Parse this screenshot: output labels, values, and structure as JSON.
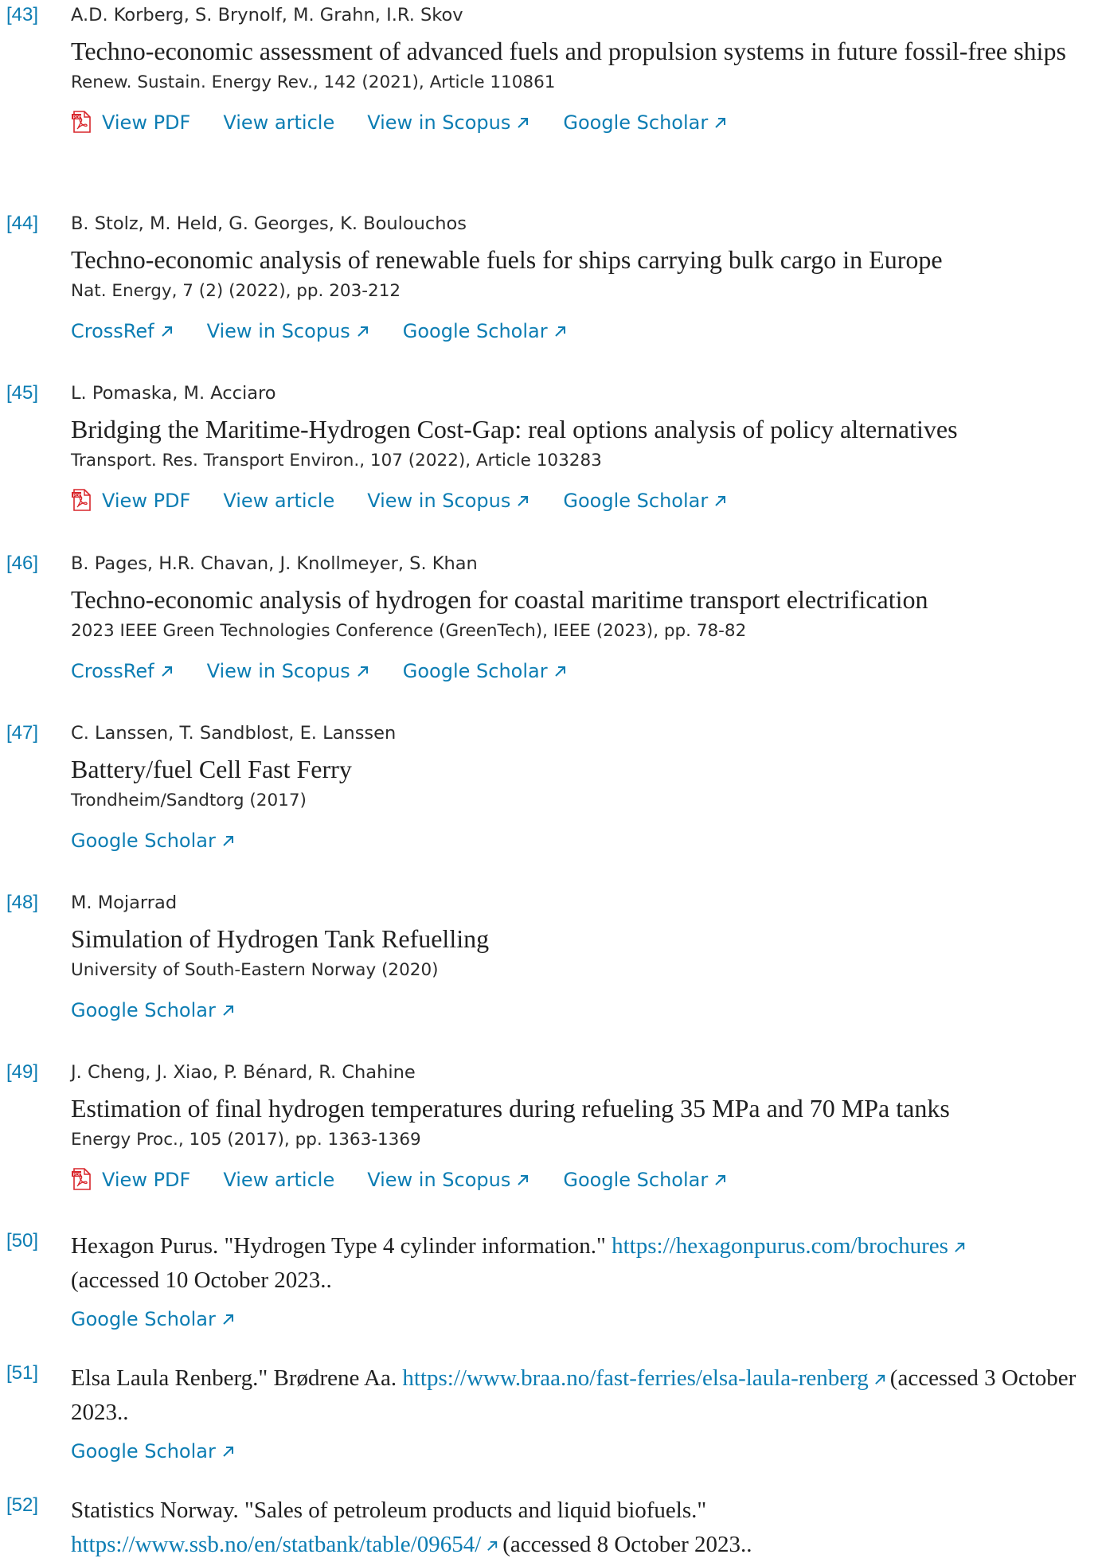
{
  "references": [
    {
      "num": "[43]",
      "authors": "A.D. Korberg, S. Brynolf, M. Grahn, I.R. Skov",
      "title": "Techno-economic assessment of advanced fuels and propulsion systems in future fossil-free ships",
      "source": "Renew. Sustain. Energy Rev., 142 (2021), Article 110861",
      "links": [
        "View PDF",
        "View article",
        "View in Scopus",
        "Google Scholar"
      ]
    },
    {
      "num": "[44]",
      "authors": "B. Stolz, M. Held, G. Georges, K. Boulouchos",
      "title": "Techno-economic analysis of renewable fuels for ships carrying bulk cargo in Europe",
      "source": "Nat. Energy, 7 (2) (2022), pp. 203-212",
      "links": [
        "CrossRef",
        "View in Scopus",
        "Google Scholar"
      ]
    },
    {
      "num": "[45]",
      "authors": "L. Pomaska, M. Acciaro",
      "title": "Bridging the Maritime-Hydrogen Cost-Gap: real options analysis of policy alternatives",
      "source": "Transport. Res. Transport Environ., 107 (2022), Article 103283",
      "links": [
        "View PDF",
        "View article",
        "View in Scopus",
        "Google Scholar"
      ]
    },
    {
      "num": "[46]",
      "authors": "B. Pages, H.R. Chavan, J. Knollmeyer, S. Khan",
      "title": "Techno-economic analysis of hydrogen for coastal maritime transport electrification",
      "source": "2023 IEEE Green Technologies Conference (GreenTech), IEEE (2023), pp. 78-82",
      "links": [
        "CrossRef",
        "View in Scopus",
        "Google Scholar"
      ]
    },
    {
      "num": "[47]",
      "authors": "C. Lanssen, T. Sandblost, E. Lanssen",
      "title": "Battery/fuel Cell Fast Ferry",
      "source": "Trondheim/Sandtorg (2017)",
      "links": [
        "Google Scholar"
      ]
    },
    {
      "num": "[48]",
      "authors": "M. Mojarrad",
      "title": "Simulation of Hydrogen Tank Refuelling",
      "source": "University of South-Eastern Norway (2020)",
      "links": [
        "Google Scholar"
      ]
    },
    {
      "num": "[49]",
      "authors": "J. Cheng, J. Xiao, P. Bénard, R. Chahine",
      "title": "Estimation of final hydrogen temperatures during refueling 35 MPa and 70 MPa tanks",
      "source": "Energy Proc., 105 (2017), pp. 1363-1369",
      "links": [
        "View PDF",
        "View article",
        "View in Scopus",
        "Google Scholar"
      ]
    },
    {
      "num": "[50]",
      "text_before": "Hexagon Purus. \"Hydrogen Type 4 cylinder information.\" ",
      "url": "https://hexagonpurus.com/brochures",
      "text_after": "(accessed 10 October 2023..",
      "links": [
        "Google Scholar"
      ]
    },
    {
      "num": "[51]",
      "text_before": "Elsa Laula Renberg.\" Brødrene Aa. ",
      "url": "https://www.braa.no/fast-ferries/elsa-laula-renberg",
      "text_after": "(accessed 3 October 2023..",
      "links": [
        "Google Scholar"
      ]
    },
    {
      "num": "[52]",
      "text_before": "Statistics Norway. \"Sales of petroleum products and liquid biofuels.\" ",
      "url": "https://www.ssb.no/en/statbank/table/09654/",
      "text_after": "(accessed 8 October 2023..",
      "links": []
    }
  ],
  "colors": {
    "link": "#0c7db3",
    "text": "#1f1f1f",
    "pdf_red": "#d9262c"
  },
  "icons": {
    "pdf": "pdf-icon",
    "external": "external-arrow-icon"
  }
}
